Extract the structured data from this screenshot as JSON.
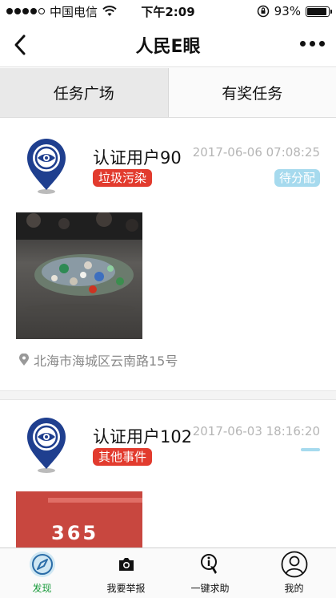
{
  "status_bar": {
    "carrier": "中国电信",
    "time": "下午2:09",
    "battery": "93%",
    "battery_level": 0.93
  },
  "nav": {
    "title": "人民E眼"
  },
  "tabs": [
    {
      "label": "任务广场",
      "active": true
    },
    {
      "label": "有奖任务",
      "active": false
    }
  ],
  "posts": [
    {
      "user": "认证用户90",
      "time": "2017-06-06 07:08:25",
      "tag": "垃圾污染",
      "status": "待分配",
      "location": "北海市海城区云南路15号"
    },
    {
      "user": "认证用户102",
      "time": "2017-06-03 18:16:20",
      "tag": "其他事件",
      "status": "",
      "photo_text": "365"
    }
  ],
  "tabbar": [
    {
      "label": "发现",
      "icon": "compass-icon",
      "active": true
    },
    {
      "label": "我要举报",
      "icon": "camera-icon",
      "active": false
    },
    {
      "label": "一键求助",
      "icon": "help-icon",
      "active": false
    },
    {
      "label": "我的",
      "icon": "user-icon",
      "active": false
    }
  ],
  "colors": {
    "accent_green": "#1a9b3c",
    "tag_red": "#e23b2e",
    "status_blue": "#a6daee",
    "brand_blue": "#1f3f8f"
  }
}
